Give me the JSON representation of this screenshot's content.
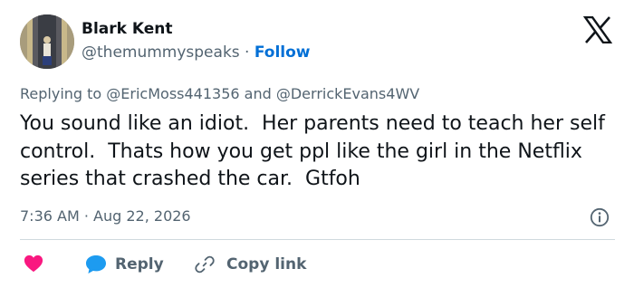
{
  "author": {
    "name": "Blark Kent",
    "handle": "@themummyspeaks",
    "separator": " · ",
    "follow_label": "Follow"
  },
  "replying": {
    "prefix": "Replying to ",
    "mention_1": "@EricMoss441356",
    "joiner": " and ",
    "mention_2": "@DerrickEvans4WV"
  },
  "tweet": {
    "text": "You sound like an idiot.  Her parents need to teach her self control.  Thats how you get ppl like the girl in the Netflix series that crashed the car.  Gtfoh"
  },
  "meta": {
    "time": "7:36 AM",
    "separator": " · ",
    "date": "Aug 22, 2026"
  },
  "actions": {
    "reply_label": "Reply",
    "copy_label": "Copy link"
  },
  "icons": {
    "logo": "x-logo-icon",
    "info": "info-icon",
    "like": "heart-icon",
    "reply": "reply-bubble-icon",
    "copy": "link-icon"
  },
  "colors": {
    "text": "#0f1419",
    "secondary": "#536471",
    "link": "#006fd6",
    "heart": "#f91880",
    "reply": "#1d9bf0",
    "divider": "#cfd9de"
  }
}
